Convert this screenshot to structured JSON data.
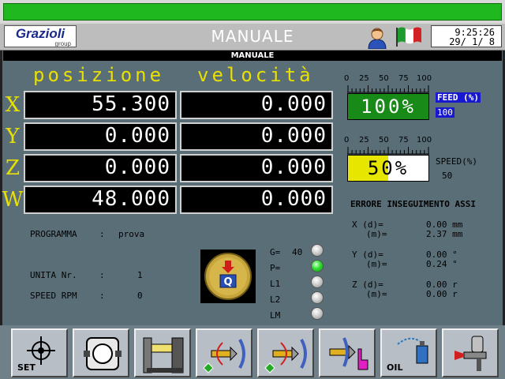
{
  "topbar": {
    "status_color": "#1fb81f"
  },
  "header": {
    "logo_name": "Grazioli",
    "logo_sub": "group",
    "mode_title": "MANUALE",
    "icons": [
      "user-icon",
      "italian-flag-icon"
    ],
    "time": "9:25:26",
    "date": "29/ 1/ 8"
  },
  "subbar_title": "MANUALE",
  "positions": {
    "header_position": "posizione",
    "header_velocity": "velocità",
    "axes": [
      {
        "axis": "X",
        "position": "55.300",
        "velocity": "0.000"
      },
      {
        "axis": "Y",
        "position": "0.000",
        "velocity": "0.000"
      },
      {
        "axis": "Z",
        "position": "0.000",
        "velocity": "0.000"
      },
      {
        "axis": "W",
        "position": "48.000",
        "velocity": "0.000"
      }
    ]
  },
  "feed": {
    "scale": [
      "0",
      "25",
      "50",
      "75",
      "100"
    ],
    "value_text": "100%",
    "value_fraction": 1.0,
    "label": "FEED (%)",
    "label_value": "100",
    "bar_color": "#178a17"
  },
  "speed": {
    "scale": [
      "0",
      "25",
      "50",
      "75",
      "100"
    ],
    "value_text": "50%",
    "value_fraction": 0.5,
    "label": "SPEED(%)",
    "label_value": "50",
    "bar_color": "#e6e600"
  },
  "errors": {
    "title": "ERRORE INSEGUIMENTO ASSI",
    "rows": [
      {
        "label": "X (d)=",
        "value": "0.00 mm"
      },
      {
        "label": "(m)=",
        "value": "2.37 mm"
      },
      {
        "label": "Y (d)=",
        "value": "0.00 °"
      },
      {
        "label": "(m)=",
        "value": "0.24 °"
      },
      {
        "label": "Z (d)=",
        "value": "0.00 r"
      },
      {
        "label": "(m)=",
        "value": "0.00 r"
      }
    ]
  },
  "program": {
    "programma_label": "PROGRAMMA",
    "programma_sep": ":",
    "programma_value": "prova",
    "unita_label": "UNITA Nr.",
    "unita_sep": ":",
    "unita_value": "1",
    "speed_label": "SPEED RPM",
    "speed_sep": ":",
    "speed_value": "0"
  },
  "indicators": [
    {
      "label": "G=",
      "value": "40",
      "on": false
    },
    {
      "label": "P=",
      "value": "",
      "on": true
    },
    {
      "label": "L1",
      "value": "",
      "on": false
    },
    {
      "label": "L2",
      "value": "",
      "on": false
    },
    {
      "label": "LM",
      "value": "",
      "on": false
    }
  ],
  "toolbar": {
    "buttons": [
      {
        "name": "set-button",
        "icon": "crosshair-icon",
        "caption": "SET"
      },
      {
        "name": "clamp-button",
        "icon": "clamp-icon",
        "caption": ""
      },
      {
        "name": "machine-button",
        "icon": "machine-icon",
        "caption": ""
      },
      {
        "name": "rotate-tool-left-button",
        "icon": "rotate-tool-icon",
        "caption": ""
      },
      {
        "name": "rotate-tool-right-button",
        "icon": "rotate-tool-icon",
        "caption": ""
      },
      {
        "name": "tool-hand-button",
        "icon": "tool-hand-icon",
        "caption": ""
      },
      {
        "name": "oil-button",
        "icon": "oil-can-icon",
        "caption": "OIL"
      },
      {
        "name": "spray-button",
        "icon": "spray-gun-icon",
        "caption": ""
      }
    ]
  }
}
